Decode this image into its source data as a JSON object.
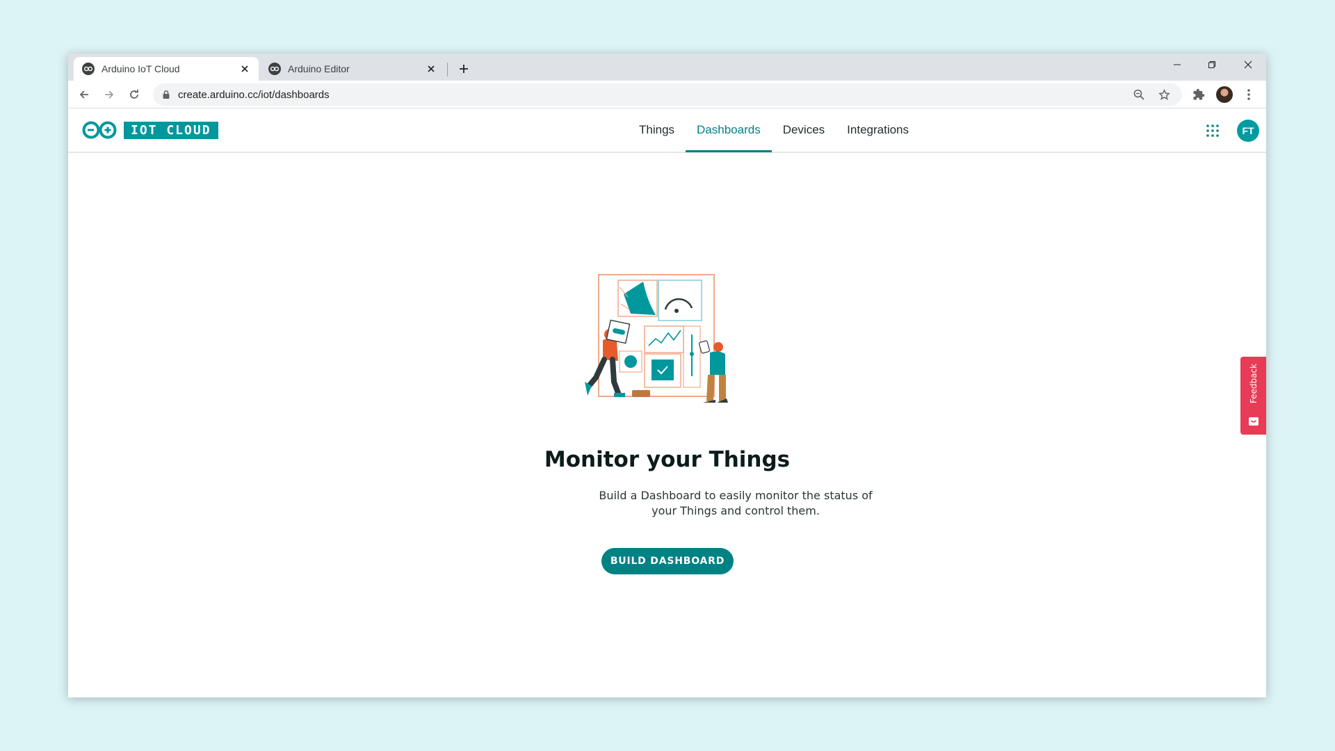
{
  "browser": {
    "tabs": [
      {
        "title": "Arduino IoT Cloud",
        "active": true
      },
      {
        "title": "Arduino Editor",
        "active": false
      }
    ],
    "url": "create.arduino.cc/iot/dashboards"
  },
  "app": {
    "logo_text": "IOT CLOUD",
    "nav": [
      {
        "label": "Things"
      },
      {
        "label": "Dashboards",
        "active": true
      },
      {
        "label": "Devices"
      },
      {
        "label": "Integrations"
      }
    ],
    "user_initials": "FT"
  },
  "main": {
    "heading": "Monitor your Things",
    "description_line1": "Build a Dashboard to easily monitor the status of",
    "description_line2": "your Things and control them.",
    "button_label": "BUILD DASHBOARD"
  },
  "feedback": {
    "label": "Feedback"
  },
  "colors": {
    "accent": "#008184",
    "brand_teal": "#00979d",
    "feedback": "#e83b55",
    "background": "#dcf4f6"
  },
  "icons": [
    "arduino-favicon",
    "close-icon",
    "plus-icon",
    "minimize-icon",
    "restore-icon",
    "back-arrow-icon",
    "forward-arrow-icon",
    "reload-icon",
    "lock-icon",
    "zoom-icon",
    "star-icon",
    "extensions-icon",
    "kebab-menu-icon",
    "apps-grid-icon",
    "feedback-icon"
  ]
}
